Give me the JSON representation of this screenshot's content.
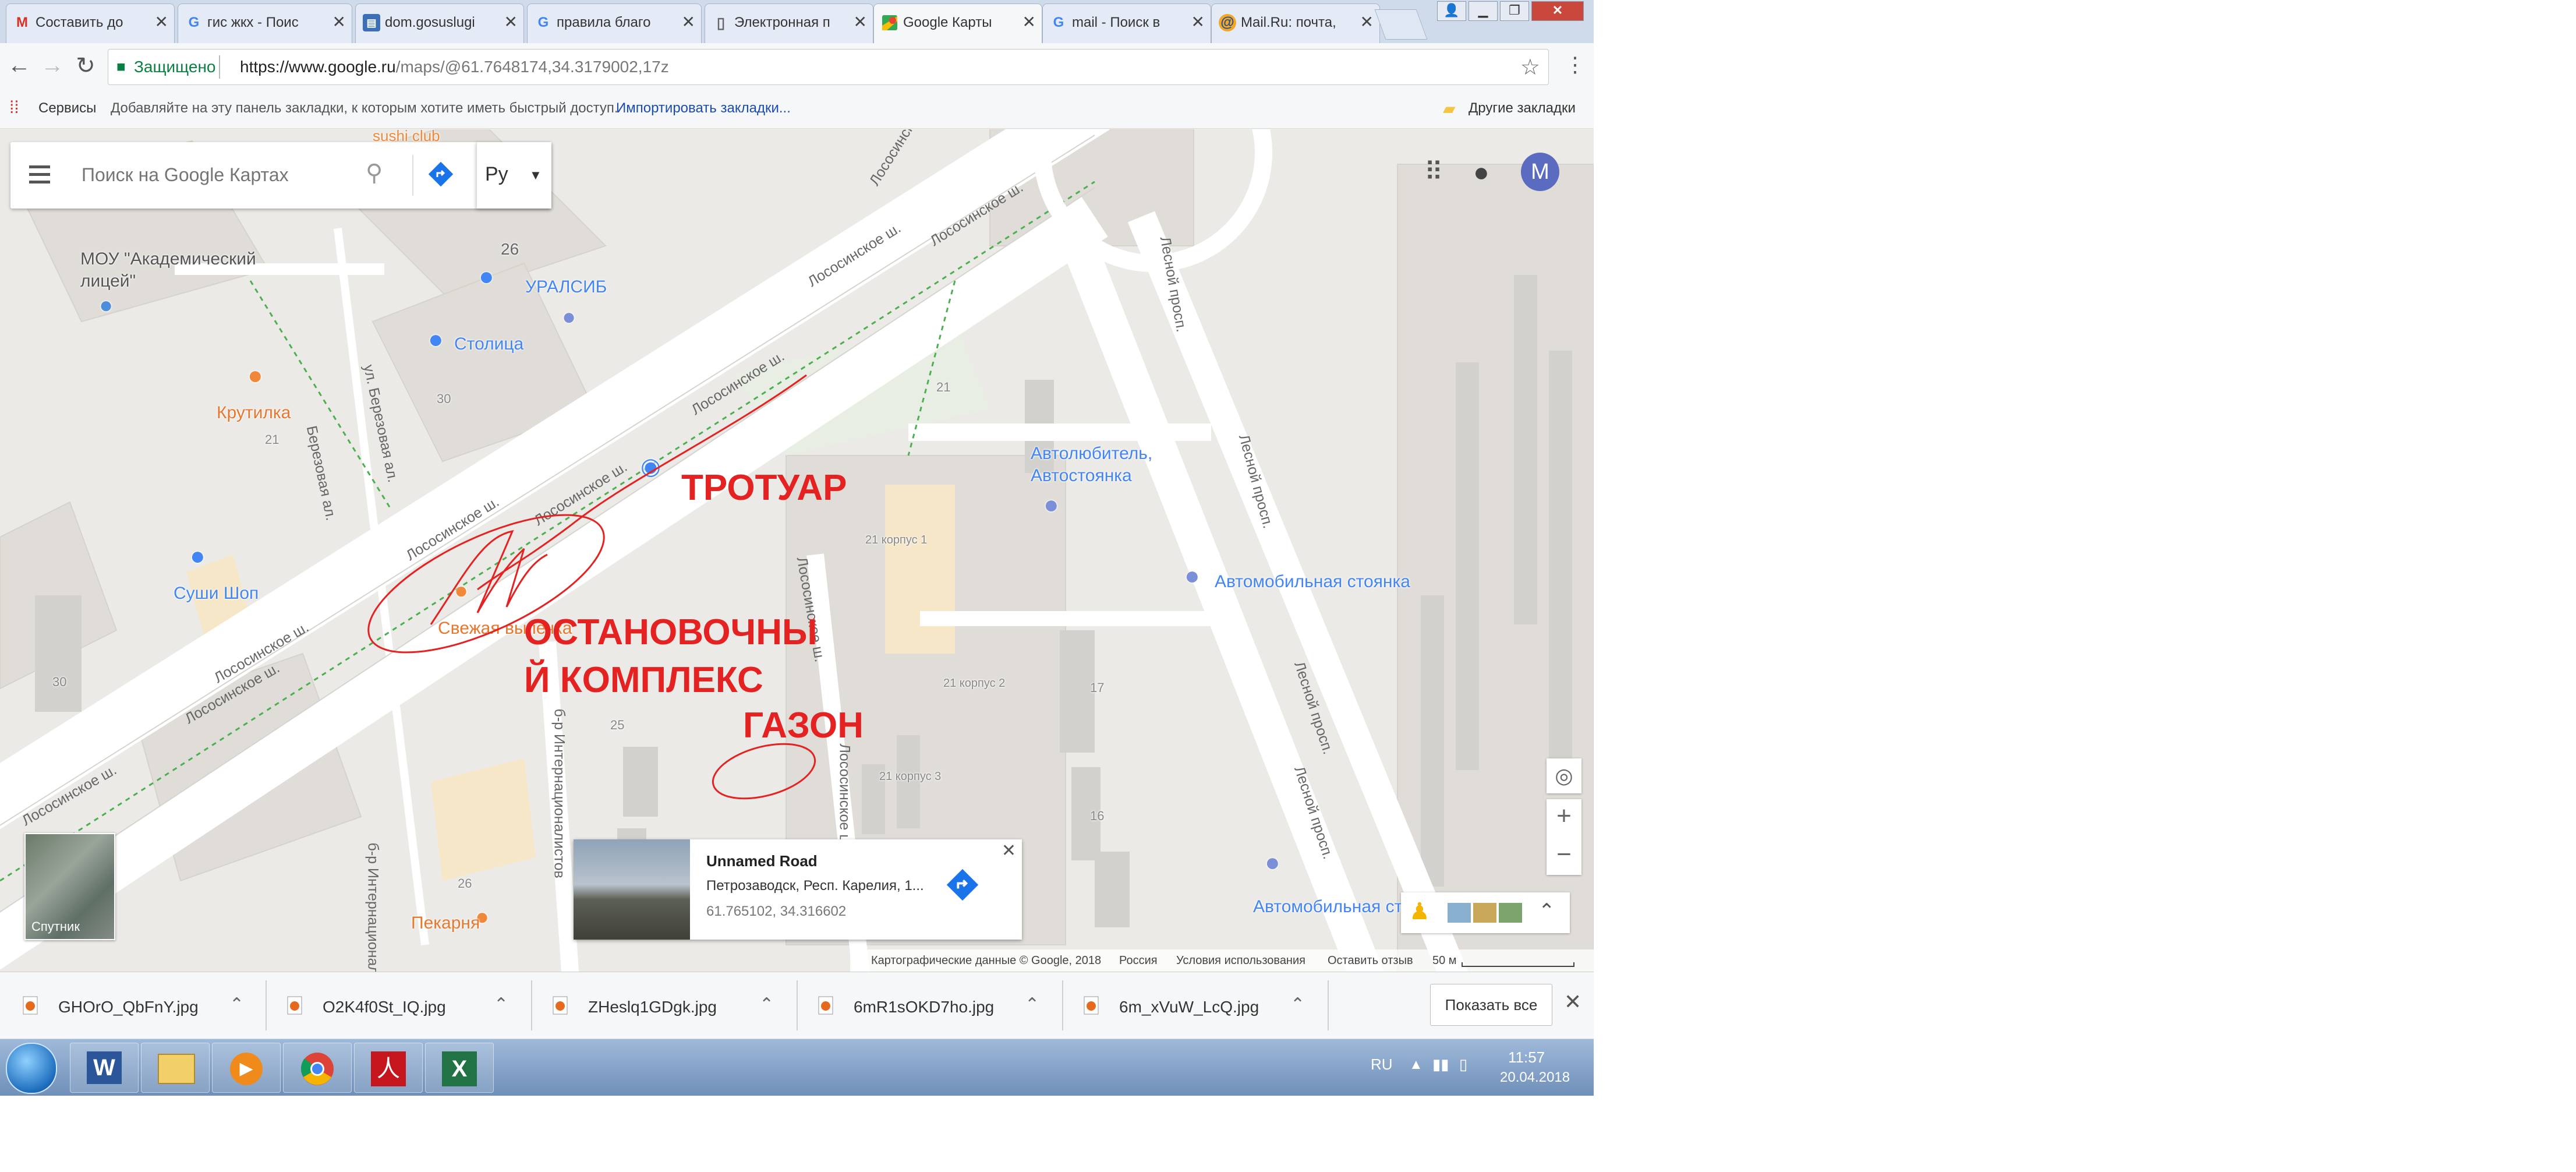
{
  "browser": {
    "tabs": [
      {
        "title": "Составить до",
        "icon": "gmail-icon"
      },
      {
        "title": "гис жкх - Поис",
        "icon": "google-icon"
      },
      {
        "title": "dom.gosuslugi",
        "icon": "doc-icon"
      },
      {
        "title": "правила благо",
        "icon": "google-icon"
      },
      {
        "title": "Электронная п",
        "icon": "page-icon"
      },
      {
        "title": "Google Карты",
        "icon": "maps-icon"
      },
      {
        "title": "mail - Поиск в",
        "icon": "google-icon"
      },
      {
        "title": "Mail.Ru: почта,",
        "icon": "mailru-icon"
      }
    ],
    "active_tab": 5,
    "secure_label": "Защищено",
    "url_host": "https://www.google.ru",
    "url_path": "/maps/@61.7648174,34.3179002,17z",
    "bookmarks": {
      "services": "Сервисы",
      "hint": "Добавляйте на эту панель закладки, к которым хотите иметь быстрый доступ.",
      "import": "Импортировать закладки...",
      "other": "Другие закладки"
    }
  },
  "map": {
    "search_placeholder": "Поиск на Google Картах",
    "language": "Ру",
    "account_initial": "M",
    "satellite_label": "Спутник",
    "pois": {
      "school": "МОУ \"Академический",
      "school2": "лицей\"",
      "uralsib": "УРАЛСИБ",
      "stolitsa": "Столица",
      "krutilka": "Крутилка",
      "sushi": "Суши Шоп",
      "svezhaya": "Свежая выпечка",
      "avtolyubitel1": "Автолюбитель,",
      "avtolyubitel2": "Автостоянка",
      "avtostoyanka1": "Автомобильная стоянка",
      "avtostoyanka2": "Автомобильная сто",
      "pekarnya": "Пекарня",
      "sushi_club": "sushi club"
    },
    "streets": {
      "lososinskoe": "Лососинское ш.",
      "lesnoy": "Лесной просп.",
      "berezovaya": "ул. Березовая ал.",
      "berezovaya2": "Березовая ал.",
      "lososinskoe_ul": "Лососинское ш.",
      "internationalists": "б-р Интернационалистов",
      "internationalists2": "б-р Интернационалистов"
    },
    "numbers": {
      "n26a": "26",
      "n30a": "30",
      "n21a": "21",
      "n21b": "21",
      "n30b": "30",
      "n25": "25",
      "n26b": "26",
      "n17": "17",
      "n16": "16",
      "k1": "21 корпус 1",
      "k2": "21 корпус 2",
      "k3": "21 корпус 3"
    },
    "annotations": {
      "trotuar": "ТРОТУАР",
      "ostanovka1": "ОСТАНОВОЧНЫ",
      "ostanovka2": "Й КОМПЛЕКС",
      "gazon": "ГАЗОН"
    },
    "card": {
      "title": "Unnamed Road",
      "address": "Петрозаводск, Респ. Карелия, 1...",
      "coords": "61.765102, 34.316602"
    },
    "attribution": {
      "data": "Картографические данные © Google, 2018",
      "country": "Россия",
      "terms": "Условия использования",
      "feedback": "Оставить отзыв",
      "scale": "50 м"
    },
    "zoom_in": "+",
    "zoom_out": "−"
  },
  "downloads": {
    "items": [
      "GHOrO_QbFnY.jpg",
      "O2K4f0St_IQ.jpg",
      "ZHeslq1GDgk.jpg",
      "6mR1sOKD7ho.jpg",
      "6m_xVuW_LcQ.jpg"
    ],
    "show_all": "Показать все",
    "close": "✕"
  },
  "taskbar": {
    "apps": [
      "word-icon",
      "explorer-icon",
      "media-player-icon",
      "chrome-icon",
      "acrobat-icon",
      "excel-icon"
    ],
    "lang": "RU",
    "time": "11:57",
    "date": "20.04.2018"
  },
  "colors": {
    "annotation_red": "#e52222",
    "maps_blue": "#4285f4",
    "food_orange": "#f0883a",
    "park_green": "#34a853"
  }
}
